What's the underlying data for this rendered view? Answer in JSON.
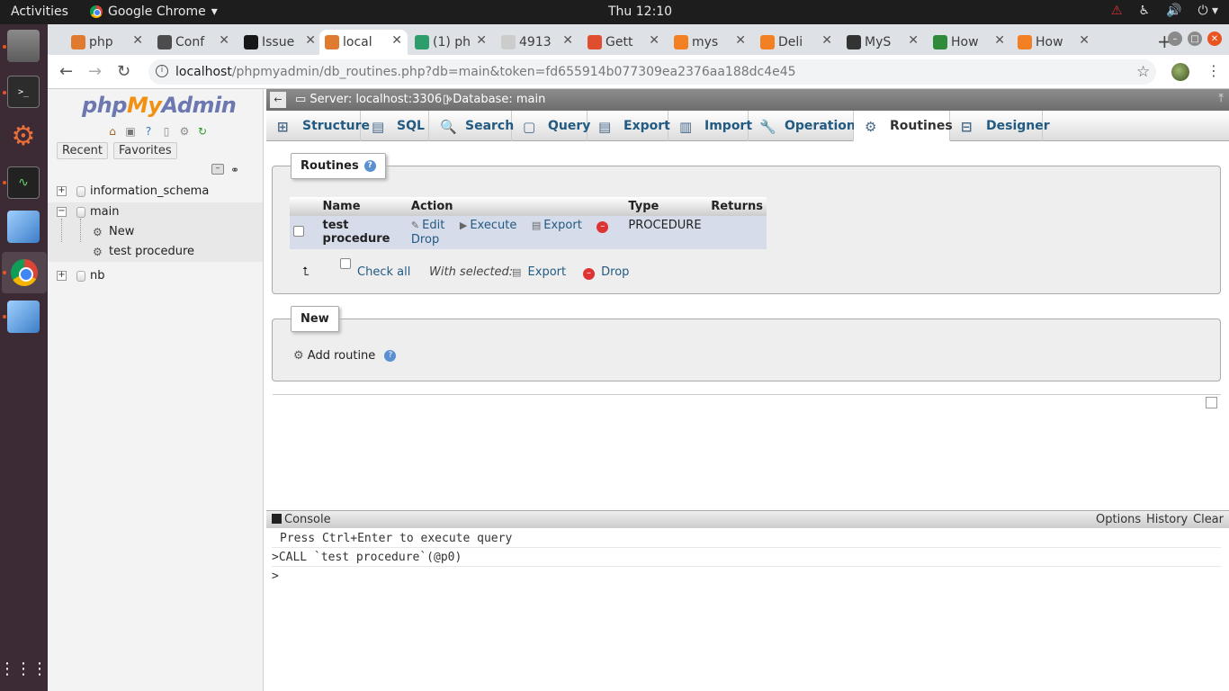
{
  "system": {
    "activities": "Activities",
    "app_name": "Google Chrome",
    "clock": "Thu 12:10"
  },
  "browser": {
    "tabs": [
      {
        "label": "php",
        "color": "#e07a2f"
      },
      {
        "label": "Conf",
        "color": "#4c4c4c"
      },
      {
        "label": "Issue",
        "color": "#181717"
      },
      {
        "label": "local",
        "color": "#e07a2f",
        "active": true
      },
      {
        "label": "(1) ph",
        "color": "#2d9e6b"
      },
      {
        "label": "4913",
        "color": "#cccccc"
      },
      {
        "label": "Gett",
        "color": "#e04d2f"
      },
      {
        "label": "mys",
        "color": "#f48024"
      },
      {
        "label": "Deli",
        "color": "#f48024"
      },
      {
        "label": "MyS",
        "color": "#333333"
      },
      {
        "label": "How",
        "color": "#2e8b3a"
      },
      {
        "label": "How",
        "color": "#f48024"
      }
    ],
    "url_host": "localhost",
    "url_path": "/phpmyadmin/db_routines.php?db=main&token=fd655914b077309ea2376aa188dc4e45"
  },
  "nav": {
    "logo_php": "php",
    "logo_my": "My",
    "logo_admin": "Admin",
    "tab_recent": "Recent",
    "tab_favorites": "Favorites",
    "tree": {
      "db1": "information_schema",
      "db2": "main",
      "new": "New",
      "routine": "test procedure",
      "db3": "nb"
    }
  },
  "breadcrumb": {
    "server": "Server: localhost:3306 »",
    "database": "Database: main"
  },
  "menu": {
    "structure": "Structure",
    "sql": "SQL",
    "search": "Search",
    "query": "Query",
    "export": "Export",
    "import": "Import",
    "operations": "Operations",
    "routines": "Routines",
    "designer": "Designer"
  },
  "routines": {
    "legend": "Routines",
    "headers": {
      "name": "Name",
      "action": "Action",
      "type": "Type",
      "returns": "Returns"
    },
    "row": {
      "name": "test procedure",
      "edit": "Edit",
      "execute": "Execute",
      "export": "Export",
      "drop": "Drop",
      "type": "PROCEDURE",
      "returns": ""
    },
    "check_all": "Check all",
    "with_selected": "With selected:",
    "bulk_export": "Export",
    "bulk_drop": "Drop"
  },
  "new_section": {
    "legend": "New",
    "add_routine": "Add routine"
  },
  "console": {
    "title": "Console",
    "options": "Options",
    "history": "History",
    "clear": "Clear",
    "hint": "Press Ctrl+Enter to execute query",
    "last_query": ">CALL `test procedure`(@p0)",
    "prompt": ">"
  }
}
